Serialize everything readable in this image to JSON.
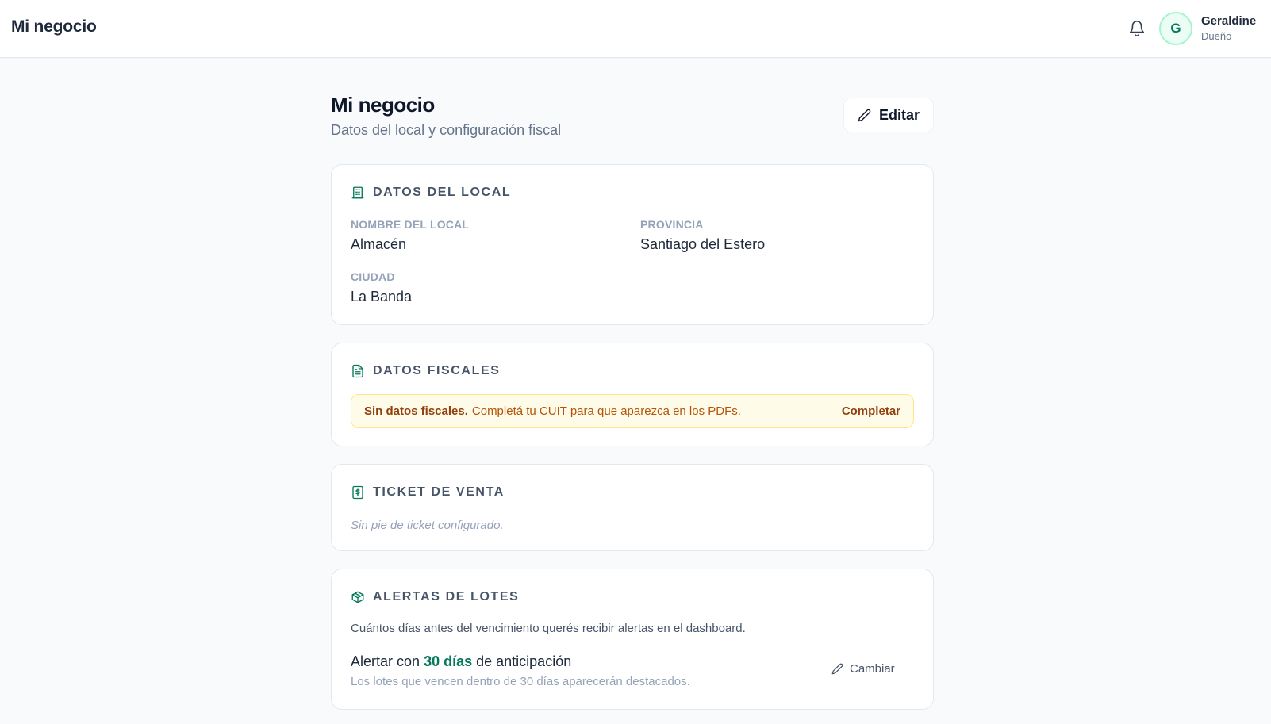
{
  "header": {
    "brand": "Mi negocio",
    "user": {
      "initial": "G",
      "name": "Geraldine",
      "role": "Dueño"
    }
  },
  "page": {
    "title": "Mi negocio",
    "subtitle": "Datos del local y configuración fiscal",
    "edit_label": "Editar"
  },
  "local": {
    "title": "DATOS DEL LOCAL",
    "nombre_label": "NOMBRE DEL LOCAL",
    "nombre_value": "Almacén",
    "provincia_label": "PROVINCIA",
    "provincia_value": "Santiago del Estero",
    "ciudad_label": "CIUDAD",
    "ciudad_value": "La Banda"
  },
  "fiscal": {
    "title": "DATOS FISCALES",
    "warning_strong": "Sin datos fiscales.",
    "warning_text": "Completá tu CUIT para que aparezca en los PDFs.",
    "warning_link": "Completar"
  },
  "ticket": {
    "title": "TICKET DE VENTA",
    "empty_text": "Sin pie de ticket configurado."
  },
  "lotes": {
    "title": "ALERTAS DE LOTES",
    "description": "Cuántos días antes del vencimiento querés recibir alertas en el dashboard.",
    "alert_prefix": "Alertar con",
    "alert_days": "30 días",
    "alert_suffix": "de anticipación",
    "note": "Los lotes que vencen dentro de 30 días aparecerán destacados.",
    "change_label": "Cambiar"
  },
  "colors": {
    "accent": "#047857",
    "warning_bg": "#fefce8",
    "warning_text": "#92400e"
  }
}
